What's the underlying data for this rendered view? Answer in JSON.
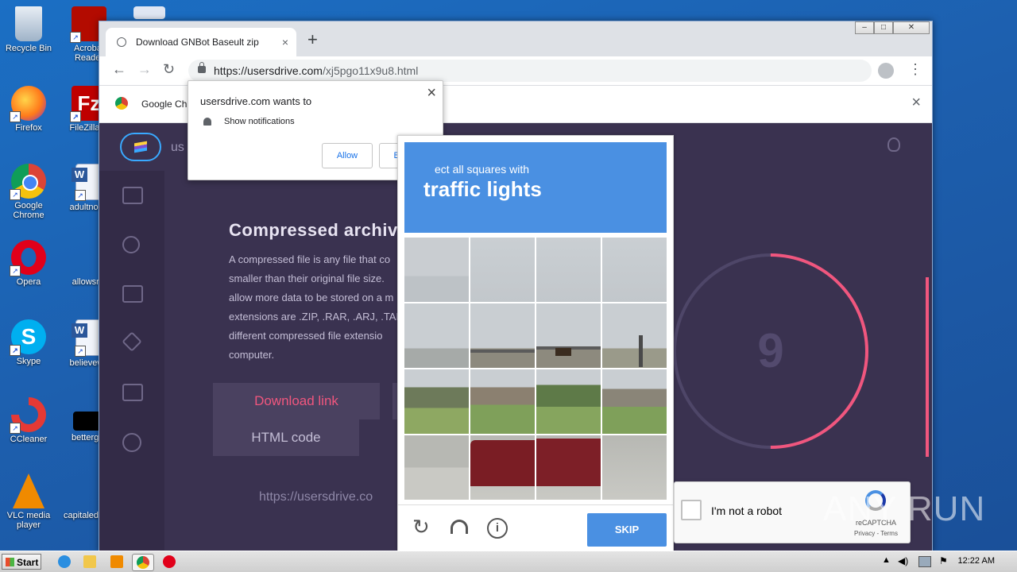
{
  "desktop": {
    "icons": [
      {
        "label": "Recycle Bin"
      },
      {
        "label": "Acrobat Reader"
      },
      {
        "label": "Firefox"
      },
      {
        "label": "FileZilla C"
      },
      {
        "label": "Google Chrome"
      },
      {
        "label": "adultnorm"
      },
      {
        "label": "Opera"
      },
      {
        "label": "allowsr.p"
      },
      {
        "label": "Skype"
      },
      {
        "label": "believewe"
      },
      {
        "label": "CCleaner"
      },
      {
        "label": "bettergro"
      },
      {
        "label": "VLC media player"
      },
      {
        "label": "capitaled"
      }
    ]
  },
  "browser": {
    "tab_title": "Download GNBot Baseult zip",
    "tab_close": "×",
    "new_tab": "+",
    "url_host": "https://usersdrive.com",
    "url_path": "/xj5pgo11x9u8.html",
    "infobar_text": "Google Ch",
    "infobar_close": "×",
    "window_controls": [
      "–",
      "□",
      "✕"
    ]
  },
  "notification": {
    "title": "usersdrive.com wants to",
    "permission": "Show notifications",
    "allow": "Allow",
    "block": "Block",
    "close": "×"
  },
  "site": {
    "logo_text": "us",
    "heading": "Compressed archive",
    "paragraph_lines": [
      "A compressed file is any file that co",
      "smaller than their original file size.",
      "allow more data to be stored on a m",
      "extensions are .ZIP, .RAR, .ARJ, .TAR.",
      "different compressed file extensio",
      "computer."
    ],
    "download_link": "Download link",
    "html_code": "HTML code",
    "link_preview": "https://usersdrive.co",
    "countdown": "9",
    "accent": "#f0567e"
  },
  "captcha": {
    "instruction": "Select all squares with",
    "instruction_visible": "ect all squares with",
    "target": "traffic lights",
    "skip": "SKIP",
    "accent": "#4a90e2"
  },
  "recaptcha": {
    "label": "I'm not a robot",
    "brand": "reCAPTCHA",
    "links": "Privacy - Terms"
  },
  "watermark": "ANY RUN",
  "taskbar": {
    "start": "Start",
    "clock": "12:22 AM"
  }
}
